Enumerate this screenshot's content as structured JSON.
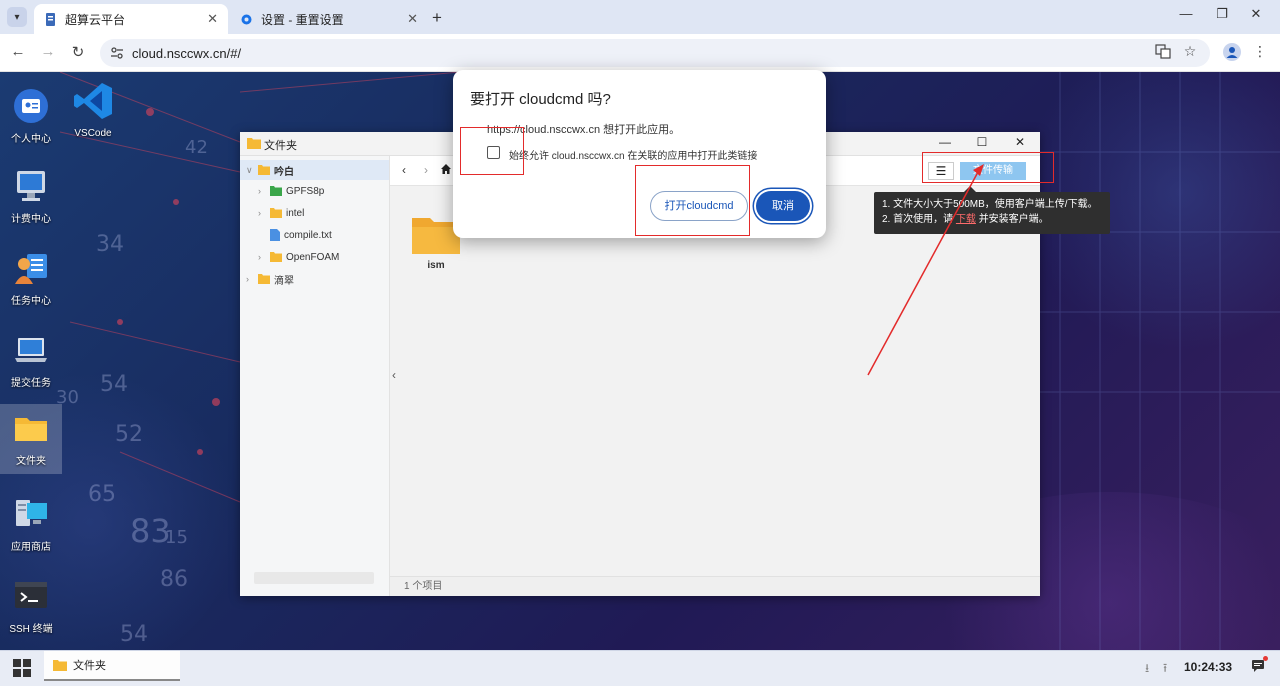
{
  "browser": {
    "tabs": [
      {
        "title": "超算云平台",
        "active": true
      },
      {
        "title": "设置 - 重置设置",
        "active": false
      }
    ],
    "url": "cloud.nsccwx.cn/#/"
  },
  "desktop": {
    "icons": [
      {
        "label": "个人中心"
      },
      {
        "label": "VSCode"
      },
      {
        "label": "计费中心"
      },
      {
        "label": "任务中心"
      },
      {
        "label": "提交任务"
      },
      {
        "label": "文件夹"
      },
      {
        "label": "应用商店"
      },
      {
        "label": "SSH 终端"
      }
    ],
    "bg_numbers": [
      "54",
      "52",
      "65",
      "83",
      "86",
      "54",
      "42",
      "34",
      "15",
      "30"
    ]
  },
  "file_window": {
    "title": "文件夹",
    "tree": [
      {
        "label": "吟白"
      },
      {
        "label": "GPFS8p"
      },
      {
        "label": "intel"
      },
      {
        "label": "compile.txt"
      },
      {
        "label": "OpenFOAM"
      },
      {
        "label": "滴翠"
      }
    ],
    "items": [
      {
        "name": "ism"
      }
    ],
    "status": "1 个项目",
    "transfer_button": "文件传输"
  },
  "tooltip": {
    "line1": "1. 文件大小大于500MB，使用客户端上传/下载。",
    "line2_pre": "2. 首次使用，请",
    "line2_link": "下载",
    "line2_post": "并安装客户端。"
  },
  "dialog": {
    "title": "要打开 cloudcmd 吗?",
    "message": "https://cloud.nsccwx.cn 想打开此应用。",
    "checkbox_label": "始终允许 cloud.nsccwx.cn 在关联的应用中打开此类链接",
    "checkbox_checked": false,
    "open_button": "打开cloudcmd",
    "cancel_button": "取消"
  },
  "taskbar": {
    "active_item": "文件夹",
    "clock": "10:24:33"
  },
  "colors": {
    "accent": "#1a56b8",
    "annotation": "#e32b2b",
    "transfer_button": "#8ec6f0"
  }
}
